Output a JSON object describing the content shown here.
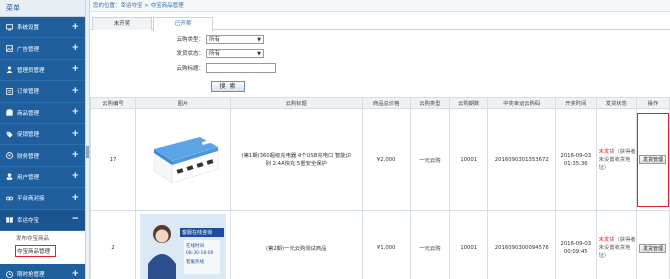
{
  "sidebar": {
    "title": "菜单",
    "items": [
      {
        "label": "系统设置",
        "icon": "monitor-icon",
        "toggle": "+"
      },
      {
        "label": "广告管理",
        "icon": "image-icon",
        "toggle": "+"
      },
      {
        "label": "管理员管理",
        "icon": "users-icon",
        "toggle": "+"
      },
      {
        "label": "订单管理",
        "icon": "list-icon",
        "toggle": "+"
      },
      {
        "label": "商品管理",
        "icon": "box-icon",
        "toggle": "+"
      },
      {
        "label": "促销管理",
        "icon": "tag-icon",
        "toggle": "+"
      },
      {
        "label": "财务管理",
        "icon": "coin-icon",
        "toggle": "+"
      },
      {
        "label": "用户管理",
        "icon": "user-icon",
        "toggle": "+"
      },
      {
        "label": "平台商对接",
        "icon": "link-icon",
        "toggle": "+"
      },
      {
        "label": "幸运夺宝",
        "icon": "gift-icon",
        "toggle": "−"
      }
    ],
    "subitems": [
      {
        "label": "发布夺宝商品"
      },
      {
        "label": "夺宝商品管理"
      }
    ],
    "bottom_item": {
      "label": "限时抢管理",
      "icon": "clock-icon",
      "toggle": "+"
    }
  },
  "breadcrumb": "您的位置：幸运夺宝 > 夺宝商品管理",
  "tabs": [
    {
      "label": "未开奖"
    },
    {
      "label": "已开奖"
    }
  ],
  "filters": {
    "type_label": "云购类型：",
    "type_value": "所有",
    "status_label": "发货状态：",
    "status_value": "所有",
    "title_label": "云购标题：",
    "title_value": "",
    "search_label": "搜 索"
  },
  "table": {
    "headers": [
      "云购编号",
      "图片",
      "云购标题",
      "商品总价格",
      "云购类型",
      "云购期数",
      "中奖幸运云购码",
      "开奖时间",
      "发货状态",
      "操作"
    ],
    "rows": [
      {
        "id": "17",
        "title": "(第1期)360超级充电器 4个USB充电口 智能识别 2.4A快充 5重安全保护",
        "price": "¥2,000",
        "type": "一元云购",
        "period": "10001",
        "code": "20160903013536​72",
        "date": "2016-09-03",
        "time": "01:35:36",
        "status_main": "未发货",
        "status_note": "（获得者未设置收货地址）",
        "action": "发货管理"
      },
      {
        "id": "2",
        "title": "(第2期)一元云购测试商品",
        "price": "¥1,000",
        "type": "一元云购",
        "period": "10001",
        "code": "20160903000945​76",
        "date": "2016-09-03",
        "time": "00:09:45",
        "status_main": "未发货",
        "status_note": "（获得者未设置收货地址）",
        "action": "发货管理"
      }
    ],
    "row2_image_text": [
      "客服在线咨询",
      "在线时间",
      "08:30-18:00",
      "客服热线"
    ]
  },
  "colors": {
    "sidebar_bg": "#1f5f9e",
    "highlight_red": "#e0222a",
    "status_red": "#e0222a"
  }
}
